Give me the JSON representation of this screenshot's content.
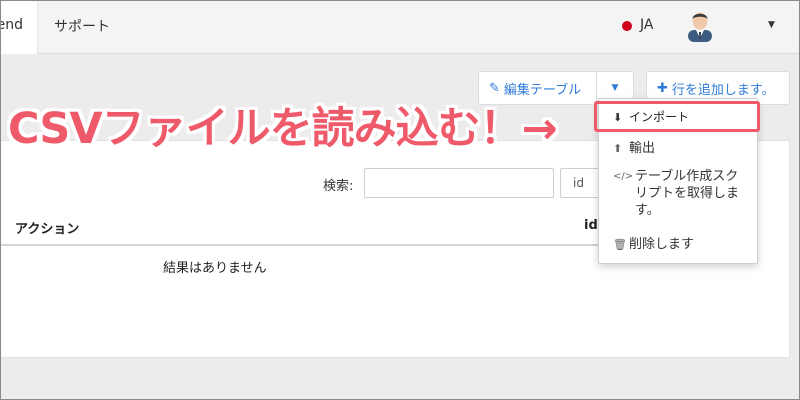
{
  "navbar": {
    "active_tab": "end",
    "support": "サポート",
    "language": "JA"
  },
  "toolbar": {
    "edit_table": "編集テーブル",
    "add_row": "行を追加します。"
  },
  "table": {
    "search_label": "検索:",
    "search_value": "",
    "column_select_value": "id",
    "columns": [
      "アクション",
      "id"
    ],
    "empty_message": "結果はありません"
  },
  "dropdown": {
    "items": [
      {
        "label": "インポート",
        "icon": "download-icon"
      },
      {
        "label": "輸出",
        "icon": "upload-icon"
      },
      {
        "label": "テーブル作成スクリプトを取得します。",
        "icon": "code-icon"
      },
      {
        "label": "削除します",
        "icon": "trash-icon"
      }
    ]
  },
  "annotation": {
    "text": "CSVファイルを読み込む！→"
  },
  "colors": {
    "accent": "#2f7bd6",
    "annotation": "#ef5a6a",
    "status_dot": "#d0021b"
  }
}
